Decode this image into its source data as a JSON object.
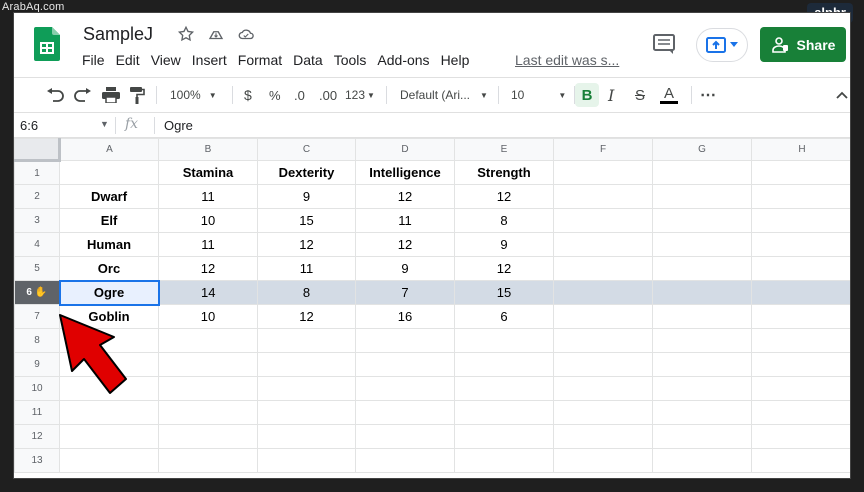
{
  "watermarks": {
    "left": "ArabAq.com",
    "right": "alphr"
  },
  "app": {
    "doc_title": "SampleJ",
    "menu": [
      "File",
      "Edit",
      "View",
      "Insert",
      "Format",
      "Data",
      "Tools",
      "Add-ons",
      "Help"
    ],
    "last_edit": "Last edit was s...",
    "share_label": "Share"
  },
  "toolbar": {
    "zoom": "100%",
    "currency": "$",
    "percent": "%",
    "decimal_dec": ".0",
    "decimal_inc": ".00",
    "more_formats": "123",
    "font": "Default (Ari...",
    "font_size": "10",
    "bold": "B",
    "italic": "I",
    "strike": "S",
    "text_color": "A",
    "more": "⋯"
  },
  "formula_bar": {
    "name_box": "6:6",
    "fx": "fx",
    "value": "Ogre"
  },
  "grid": {
    "columns": [
      "A",
      "B",
      "C",
      "D",
      "E",
      "F",
      "G",
      "H"
    ],
    "rows": [
      [
        "1",
        "",
        "Stamina",
        "Dexterity",
        "Intelligence",
        "Strength",
        "",
        "",
        ""
      ],
      [
        "2",
        "Dwarf",
        "11",
        "9",
        "12",
        "12",
        "",
        "",
        ""
      ],
      [
        "3",
        "Elf",
        "10",
        "15",
        "11",
        "8",
        "",
        "",
        ""
      ],
      [
        "4",
        "Human",
        "11",
        "12",
        "12",
        "9",
        "",
        "",
        ""
      ],
      [
        "5",
        "Orc",
        "12",
        "11",
        "9",
        "12",
        "",
        "",
        ""
      ],
      [
        "6",
        "Ogre",
        "14",
        "8",
        "7",
        "15",
        "",
        "",
        ""
      ],
      [
        "7",
        "Goblin",
        "10",
        "12",
        "16",
        "6",
        "",
        "",
        ""
      ],
      [
        "8",
        "",
        "",
        "",
        "",
        "",
        "",
        "",
        ""
      ],
      [
        "9",
        "",
        "",
        "",
        "",
        "",
        "",
        "",
        ""
      ],
      [
        "10",
        "",
        "",
        "",
        "",
        "",
        "",
        "",
        ""
      ],
      [
        "11",
        "",
        "",
        "",
        "",
        "",
        "",
        "",
        ""
      ],
      [
        "12",
        "",
        "",
        "",
        "",
        "",
        "",
        "",
        ""
      ],
      [
        "13",
        "",
        "",
        "",
        "",
        "",
        "",
        "",
        ""
      ]
    ],
    "selected_row": "6"
  },
  "colors": {
    "accent": "#188038",
    "selection": "#d3dbe5",
    "active_border": "#1a73e8",
    "annotation_arrow": "#e00000"
  }
}
